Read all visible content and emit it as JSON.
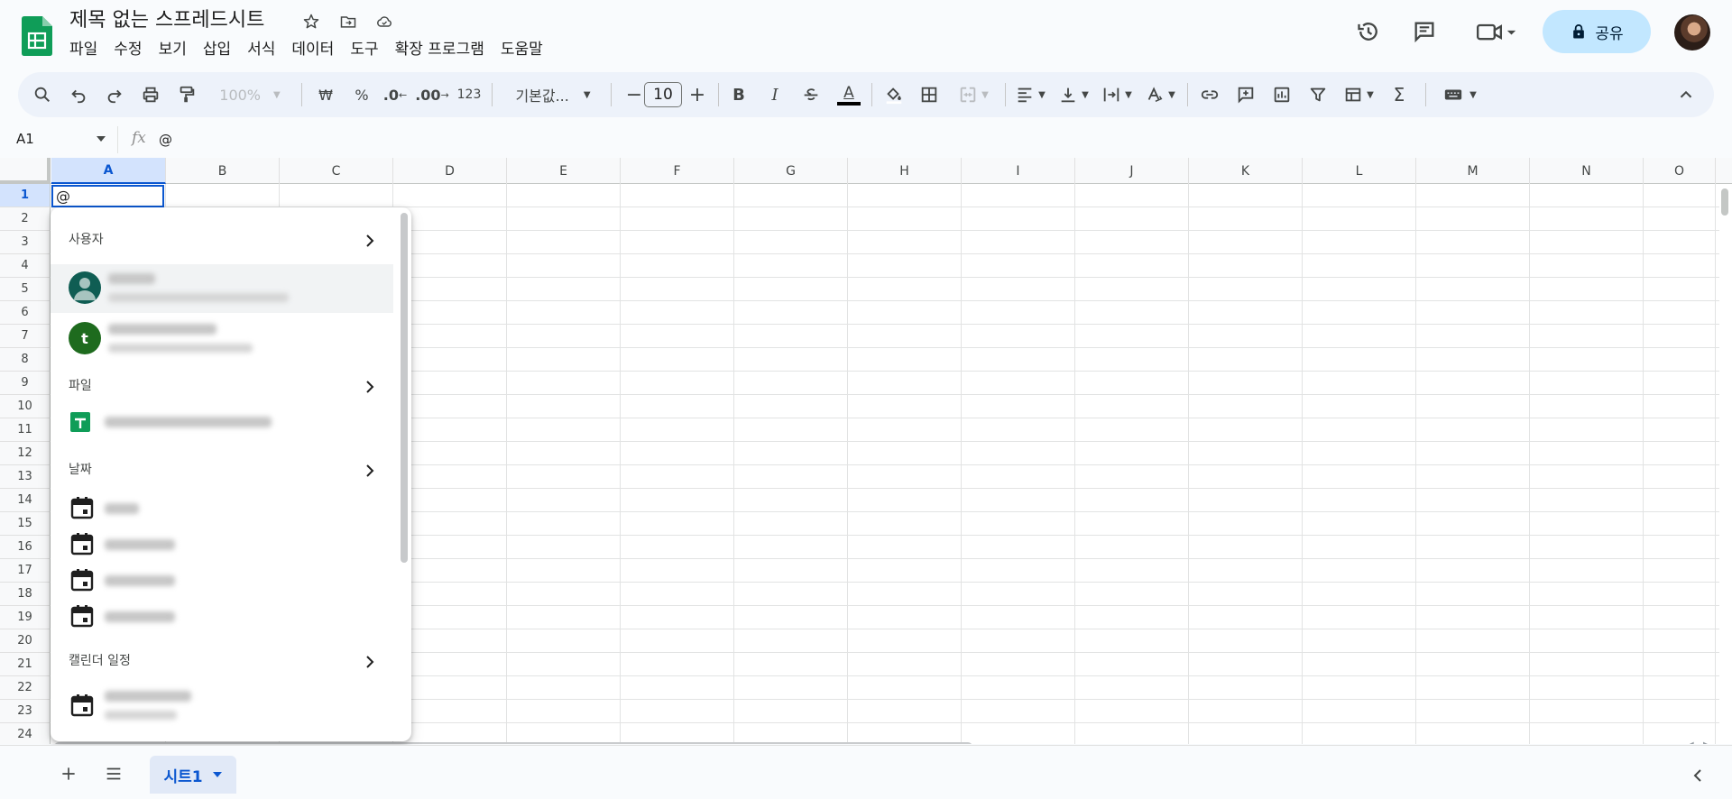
{
  "header": {
    "title": "제목 없는 스프레드시트",
    "menu": [
      "파일",
      "수정",
      "보기",
      "삽입",
      "서식",
      "데이터",
      "도구",
      "확장 프로그램",
      "도움말"
    ],
    "share_label": "공유"
  },
  "toolbar": {
    "zoom": "100%",
    "currency": "₩",
    "percent": "%",
    "dec_decrease": ".0",
    "dec_increase": ".00",
    "number_format": "123",
    "font": "기본값...",
    "font_size": "10",
    "bold": "B",
    "italic": "I",
    "text_color": "A",
    "sum": "Σ"
  },
  "formula_bar": {
    "cell_ref": "A1",
    "fx": "fx",
    "content": "@"
  },
  "grid": {
    "columns": [
      "A",
      "B",
      "C",
      "D",
      "E",
      "F",
      "G",
      "H",
      "I",
      "J",
      "K",
      "L",
      "M",
      "N",
      "O"
    ],
    "rows": [
      "1",
      "2",
      "3",
      "4",
      "5",
      "6",
      "7",
      "8",
      "9",
      "10",
      "11",
      "12",
      "13",
      "14",
      "15",
      "16",
      "17",
      "18",
      "19",
      "20",
      "21",
      "22",
      "23",
      "24"
    ],
    "active_cell_value": "@"
  },
  "mention_menu": {
    "sections": {
      "people": "사용자",
      "files": "파일",
      "dates": "날짜",
      "calendar": "캘린더 일정"
    },
    "people": [
      {
        "avatar_letter": ""
      },
      {
        "avatar_letter": "t"
      }
    ]
  },
  "bottom": {
    "sheet_name": "시트1"
  },
  "colors": {
    "accent": "#0b57d0",
    "sheets_green": "#0f9d58",
    "share_bg": "#c2e7ff"
  }
}
